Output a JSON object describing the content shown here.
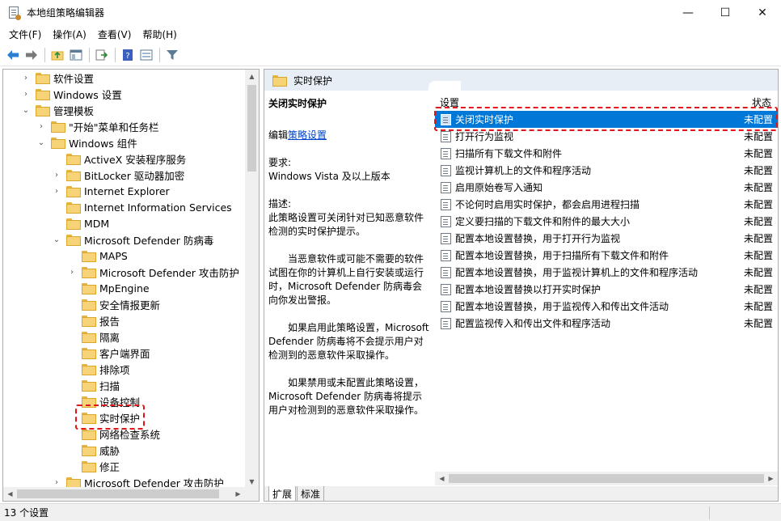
{
  "window": {
    "title": "本地组策略编辑器",
    "minimize": "—",
    "maximize": "☐",
    "close": "✕"
  },
  "menu": [
    "文件(F)",
    "操作(A)",
    "查看(V)",
    "帮助(H)"
  ],
  "tree": [
    {
      "label": "软件设置",
      "level": 0,
      "expander": "›"
    },
    {
      "label": "Windows 设置",
      "level": 0,
      "expander": "›"
    },
    {
      "label": "管理模板",
      "level": 0,
      "expander": "⌄"
    },
    {
      "label": "\"开始\"菜单和任务栏",
      "level": 1,
      "expander": "›"
    },
    {
      "label": "Windows 组件",
      "level": 1,
      "expander": "⌄"
    },
    {
      "label": "ActiveX 安装程序服务",
      "level": 2,
      "expander": ""
    },
    {
      "label": "BitLocker 驱动器加密",
      "level": 2,
      "expander": "›"
    },
    {
      "label": "Internet Explorer",
      "level": 2,
      "expander": "›"
    },
    {
      "label": "Internet Information Services",
      "level": 2,
      "expander": ""
    },
    {
      "label": "MDM",
      "level": 2,
      "expander": ""
    },
    {
      "label": "Microsoft Defender 防病毒",
      "level": 2,
      "expander": "⌄"
    },
    {
      "label": "MAPS",
      "level": 3,
      "expander": ""
    },
    {
      "label": "Microsoft Defender 攻击防护",
      "level": 3,
      "expander": "›"
    },
    {
      "label": "MpEngine",
      "level": 3,
      "expander": ""
    },
    {
      "label": "安全情报更新",
      "level": 3,
      "expander": ""
    },
    {
      "label": "报告",
      "level": 3,
      "expander": ""
    },
    {
      "label": "隔离",
      "level": 3,
      "expander": ""
    },
    {
      "label": "客户端界面",
      "level": 3,
      "expander": ""
    },
    {
      "label": "排除项",
      "level": 3,
      "expander": ""
    },
    {
      "label": "扫描",
      "level": 3,
      "expander": ""
    },
    {
      "label": "设备控制",
      "level": 3,
      "expander": ""
    },
    {
      "label": "实时保护",
      "level": 3,
      "expander": "",
      "highlighted": true
    },
    {
      "label": "网络检查系统",
      "level": 3,
      "expander": ""
    },
    {
      "label": "威胁",
      "level": 3,
      "expander": ""
    },
    {
      "label": "修正",
      "level": 3,
      "expander": ""
    },
    {
      "label": "Microsoft Defender 攻击防护",
      "level": 2,
      "expander": "›"
    }
  ],
  "right": {
    "header": "实时保护",
    "desc": {
      "title": "关闭实时保护",
      "edit_prefix": "编辑",
      "edit_link": "策略设置",
      "req_label": "要求:",
      "req_value": "Windows Vista 及以上版本",
      "desc_label": "描述:",
      "p1": "此策略设置可关闭针对已知恶意软件检测的实时保护提示。",
      "p2": "当恶意软件或可能不需要的软件试图在你的计算机上自行安装或运行时，Microsoft Defender 防病毒会向你发出警报。",
      "p3": "如果启用此策略设置，Microsoft Defender 防病毒将不会提示用户对检测到的恶意软件采取操作。",
      "p4": "如果禁用或未配置此策略设置，Microsoft Defender 防病毒将提示用户对检测到的恶意软件采取操作。"
    },
    "columns": {
      "setting": "设置",
      "state": "状态"
    },
    "rows": [
      {
        "name": "关闭实时保护",
        "state": "未配置",
        "selected": true
      },
      {
        "name": "打开行为监视",
        "state": "未配置"
      },
      {
        "name": "扫描所有下载文件和附件",
        "state": "未配置"
      },
      {
        "name": "监视计算机上的文件和程序活动",
        "state": "未配置"
      },
      {
        "name": "启用原始卷写入通知",
        "state": "未配置"
      },
      {
        "name": "不论何时启用实时保护，都会启用进程扫描",
        "state": "未配置"
      },
      {
        "name": "定义要扫描的下载文件和附件的最大大小",
        "state": "未配置"
      },
      {
        "name": "配置本地设置替换，用于打开行为监视",
        "state": "未配置"
      },
      {
        "name": "配置本地设置替换，用于扫描所有下载文件和附件",
        "state": "未配置"
      },
      {
        "name": "配置本地设置替换，用于监视计算机上的文件和程序活动",
        "state": "未配置"
      },
      {
        "name": "配置本地设置替换以打开实时保护",
        "state": "未配置"
      },
      {
        "name": "配置本地设置替换，用于监视传入和传出文件活动",
        "state": "未配置"
      },
      {
        "name": "配置监视传入和传出文件和程序活动",
        "state": "未配置"
      }
    ],
    "tabs": [
      "扩展",
      "标准"
    ]
  },
  "status": "13 个设置",
  "colors": {
    "selection": "#0078d7",
    "highlight": "#e0161b",
    "header_bg": "#e7eef6"
  }
}
